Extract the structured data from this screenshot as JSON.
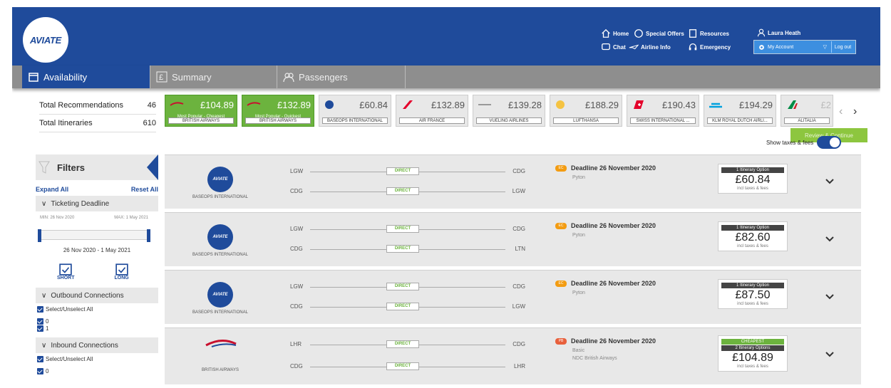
{
  "header": {
    "logo": "AVIATE",
    "nav": [
      {
        "label": "Home",
        "icon": "home-icon"
      },
      {
        "label": "Special Offers",
        "icon": "special-offers-icon"
      },
      {
        "label": "Resources",
        "icon": "resources-icon"
      },
      {
        "label": "Chat",
        "icon": "chat-icon"
      },
      {
        "label": "Airline Info",
        "icon": "plane-icon"
      },
      {
        "label": "Emergency",
        "icon": "headset-icon"
      }
    ],
    "user": "Laura Heath",
    "account": "My Account",
    "logout": "Log out"
  },
  "tabs": {
    "availability": "Availability",
    "summary": "Summary",
    "passengers": "Passengers",
    "review": "Review & Continue"
  },
  "stats": {
    "total_recommendations_label": "Total Recommendations",
    "total_recommendations": "46",
    "total_itineraries_label": "Total Itineraries",
    "total_itineraries": "610"
  },
  "airlines": [
    {
      "price": "£104.89",
      "tag": "Most Popular - Cheapest",
      "name": "BRITISH AIRWAYS"
    },
    {
      "price": "£132.89",
      "tag": "Most Popular - Quickest",
      "name": "BRITISH AIRWAYS"
    },
    {
      "price": "£60.84",
      "name": "BASEOPS INTERNATIONAL"
    },
    {
      "price": "£132.89",
      "name": "AIR FRANCE"
    },
    {
      "price": "£139.28",
      "name": "VUELING AIRLINES"
    },
    {
      "price": "£188.29",
      "name": "LUFTHANSA"
    },
    {
      "price": "£190.43",
      "name": "SWISS INTERNATIONAL ..."
    },
    {
      "price": "£194.29",
      "name": "KLM ROYAL DUTCH AIRLI..."
    },
    {
      "price": "£2",
      "name": "ALITALIA"
    }
  ],
  "toggle_label": "Show taxes & fees",
  "filters": {
    "title": "Filters",
    "expand": "Expand All",
    "reset": "Reset All",
    "ticketing": "Ticketing Deadline",
    "min": "MIN: 26 Nov 2020",
    "max": "MAX: 1 May 2021",
    "range": "26 Nov 2020 - 1 May 2021",
    "short": "SHORT",
    "long": "LONG",
    "outbound": "Outbound Connections",
    "select_all": "Select/Unselect All",
    "opt0": "0",
    "opt1": "1",
    "inbound": "Inbound Connections",
    "inbound_select_all": "Select/Unselect All",
    "inbound_opt0": "0"
  },
  "results": [
    {
      "logo": "AVIATE",
      "airline": "BASEOPS INTERNATIONAL",
      "leg1": [
        "LGW",
        "CDG"
      ],
      "leg2": [
        "CDG",
        "LGW"
      ],
      "direct": "DIRECT",
      "badge": "EC",
      "deadline": "Deadline 26 November 2020",
      "sub": "Pyton",
      "sub2": "",
      "option": "1 Itinerary Option",
      "cheapest": "",
      "price": "£60.84",
      "incl": "incl taxes & fees"
    },
    {
      "logo": "AVIATE",
      "airline": "BASEOPS INTERNATIONAL",
      "leg1": [
        "LGW",
        "CDG"
      ],
      "leg2": [
        "CDG",
        "LTN"
      ],
      "direct": "DIRECT",
      "badge": "EC",
      "deadline": "Deadline 26 November 2020",
      "sub": "Pyton",
      "sub2": "",
      "option": "1 Itinerary Option",
      "cheapest": "",
      "price": "£82.60",
      "incl": "incl taxes & fees"
    },
    {
      "logo": "AVIATE",
      "airline": "BASEOPS INTERNATIONAL",
      "leg1": [
        "LGW",
        "CDG"
      ],
      "leg2": [
        "CDG",
        "LGW"
      ],
      "direct": "DIRECT",
      "badge": "EC",
      "deadline": "Deadline 26 November 2020",
      "sub": "Pyton",
      "sub2": "",
      "option": "1 Itinerary Option",
      "cheapest": "",
      "price": "£87.50",
      "incl": "incl taxes & fees"
    },
    {
      "logo": "",
      "airline": "BRITISH AIRWAYS",
      "leg1": [
        "LHR",
        "CDG"
      ],
      "leg2": [
        "CDG",
        "LHR"
      ],
      "direct": "DIRECT",
      "badge": "PB",
      "deadline": "Deadline 26 November 2020",
      "sub": "Basic",
      "sub2": "NDC British Airways",
      "option": "2 Itinerary Options",
      "cheapest": "CHEAPEST",
      "price": "£104.89",
      "incl": "incl taxes & fees"
    }
  ]
}
